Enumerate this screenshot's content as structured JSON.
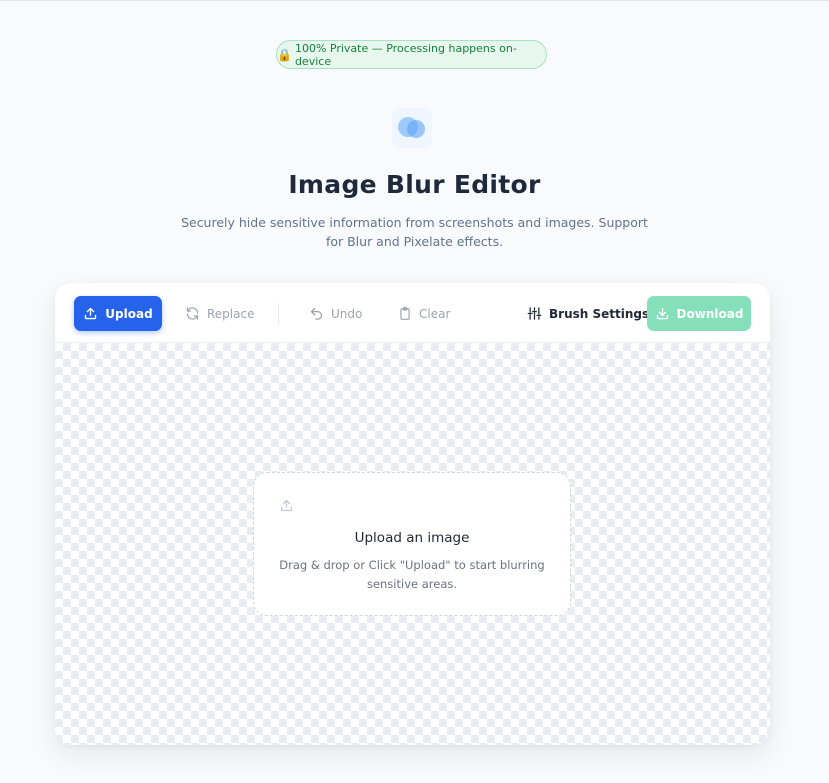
{
  "badge": {
    "icon": "lock-icon",
    "text": "100% Private — Processing happens on-device"
  },
  "header": {
    "logo_icon": "blur-circles-icon",
    "title": "Image Blur Editor",
    "subtitle": "Securely hide sensitive information from screenshots and images. Support for Blur and Pixelate effects."
  },
  "toolbar": {
    "upload_label": "Upload",
    "replace_label": "Replace",
    "undo_label": "Undo",
    "clear_label": "Clear",
    "brush_settings_label": "Brush Settings",
    "download_label": "Download"
  },
  "dropzone": {
    "title": "Upload an image",
    "text": "Drag & drop or Click \"Upload\" to start blurring sensitive areas."
  },
  "colors": {
    "primary": "#2563eb",
    "download_disabled": "#86dfbb",
    "badge_bg": "#e7f7ee",
    "badge_text": "#15803d"
  }
}
